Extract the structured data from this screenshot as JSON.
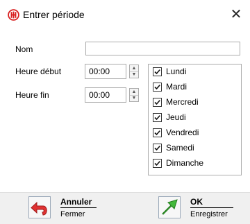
{
  "window": {
    "title": "Entrer période",
    "icon": "app-logo-icon",
    "close_label": "✕",
    "accent_color": "#d81e1e"
  },
  "form": {
    "name_label": "Nom",
    "name_value": "",
    "start_label": "Heure début",
    "start_value": "00:00",
    "end_label": "Heure fin",
    "end_value": "00:00"
  },
  "days": [
    {
      "label": "Lundi",
      "checked": true
    },
    {
      "label": "Mardi",
      "checked": true
    },
    {
      "label": "Mercredi",
      "checked": true
    },
    {
      "label": "Jeudi",
      "checked": true
    },
    {
      "label": "Vendredi",
      "checked": true
    },
    {
      "label": "Samedi",
      "checked": true
    },
    {
      "label": "Dimanche",
      "checked": true
    }
  ],
  "footer": {
    "cancel_title": "Annuler",
    "cancel_sub": "Fermer",
    "cancel_icon": "undo-arrow-icon",
    "ok_title": "OK",
    "ok_sub": "Enregistrer",
    "ok_icon": "green-arrow-icon"
  }
}
